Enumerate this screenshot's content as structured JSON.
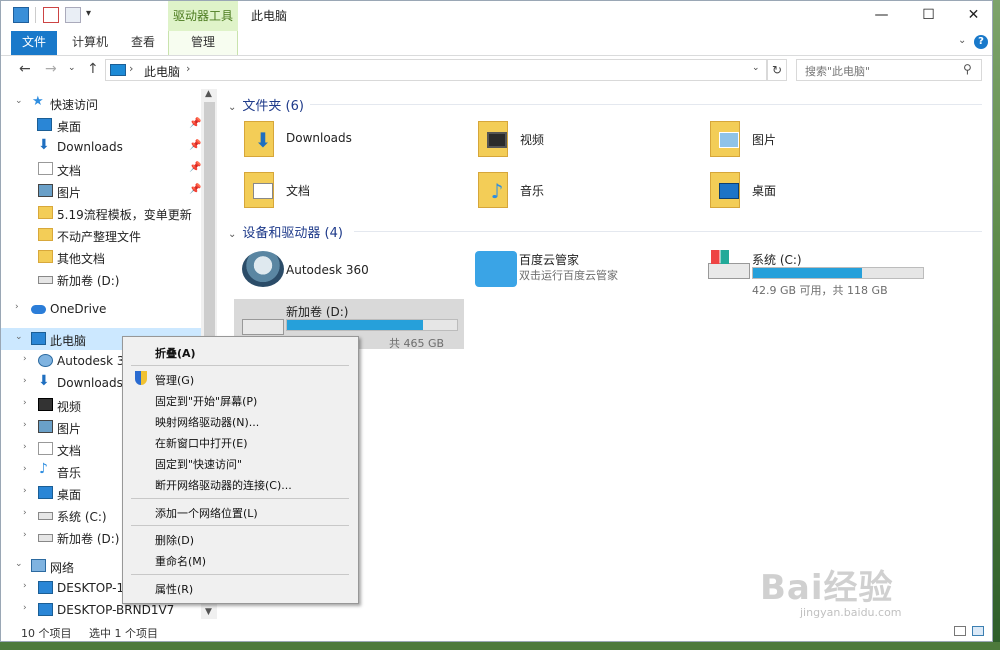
{
  "window": {
    "title": "此电脑",
    "context_tab_title": "驱动器工具",
    "controls": {
      "minimize": "—",
      "maximize": "☐",
      "close": "✕"
    }
  },
  "ribbon": {
    "tabs": [
      "文件",
      "计算机",
      "查看",
      "管理"
    ],
    "expand_icon": "chevron-down",
    "help": "?"
  },
  "address_bar": {
    "path": "此电脑",
    "search_placeholder": "搜索\"此电脑\""
  },
  "nav_pane": {
    "items": [
      {
        "label": "快速访问",
        "icon": "star"
      },
      {
        "label": "桌面",
        "icon": "desktop",
        "pinned": true
      },
      {
        "label": "Downloads",
        "icon": "download",
        "pinned": true
      },
      {
        "label": "文档",
        "icon": "document",
        "pinned": true
      },
      {
        "label": "图片",
        "icon": "picture",
        "pinned": true
      },
      {
        "label": "5.19流程模板，变单更新",
        "icon": "folder"
      },
      {
        "label": "不动产整理文件",
        "icon": "folder"
      },
      {
        "label": "其他文档",
        "icon": "folder"
      },
      {
        "label": "新加卷 (D:)",
        "icon": "drive"
      },
      {
        "label": "OneDrive",
        "icon": "cloud"
      },
      {
        "label": "此电脑",
        "icon": "pc",
        "selected": true
      },
      {
        "label": "Autodesk 360",
        "icon": "autodesk"
      },
      {
        "label": "Downloads",
        "icon": "download"
      },
      {
        "label": "视频",
        "icon": "film"
      },
      {
        "label": "图片",
        "icon": "picture"
      },
      {
        "label": "文档",
        "icon": "document"
      },
      {
        "label": "音乐",
        "icon": "music"
      },
      {
        "label": "桌面",
        "icon": "desktop"
      },
      {
        "label": "系统 (C:)",
        "icon": "drive"
      },
      {
        "label": "新加卷 (D:)",
        "icon": "drive"
      },
      {
        "label": "网络",
        "icon": "network"
      },
      {
        "label": "DESKTOP-11",
        "icon": "pc"
      },
      {
        "label": "DESKTOP-BRND1V7",
        "icon": "pc"
      }
    ]
  },
  "content": {
    "folders_header": "文件夹 (6)",
    "folders": [
      {
        "label": "Downloads",
        "overlay": "download"
      },
      {
        "label": "视频",
        "overlay": "film"
      },
      {
        "label": "图片",
        "overlay": "picture"
      },
      {
        "label": "文档",
        "overlay": "document"
      },
      {
        "label": "音乐",
        "overlay": "music"
      },
      {
        "label": "桌面",
        "overlay": "desktop"
      }
    ],
    "devices_header": "设备和驱动器 (4)",
    "devices": [
      {
        "name": "Autodesk 360",
        "icon": "autodesk"
      },
      {
        "name": "百度云管家",
        "sub": "双击运行百度云管家",
        "icon": "baidu"
      },
      {
        "name": "系统 (C:)",
        "size": "42.9 GB 可用，共 118 GB",
        "used_fraction": 0.64,
        "icon": "drive-c"
      },
      {
        "name": "新加卷 (D:)",
        "size": "共 465 GB",
        "used_fraction": 0.8,
        "icon": "drive-d",
        "selected": true
      }
    ]
  },
  "context_menu": {
    "items": [
      {
        "label": "折叠(A)",
        "bold": true
      },
      {
        "separator": true
      },
      {
        "label": "管理(G)",
        "icon": "shield"
      },
      {
        "label": "固定到\"开始\"屏幕(P)"
      },
      {
        "label": "映射网络驱动器(N)..."
      },
      {
        "label": "在新窗口中打开(E)"
      },
      {
        "label": "固定到\"快速访问\""
      },
      {
        "label": "断开网络驱动器的连接(C)..."
      },
      {
        "separator": true
      },
      {
        "label": "添加一个网络位置(L)"
      },
      {
        "separator": true
      },
      {
        "label": "删除(D)"
      },
      {
        "label": "重命名(M)"
      },
      {
        "separator": true
      },
      {
        "label": "属性(R)"
      }
    ]
  },
  "status_bar": {
    "count": "10 个项目",
    "selection": "选中 1 个项目"
  },
  "watermark": {
    "text": "Bai经验",
    "url": "jingyan.baidu.com"
  },
  "colors": {
    "accent": "#1979ca",
    "context_tab": "#dff3c9",
    "drive_fill": "#26a0da",
    "selection": "#cce8ff"
  }
}
